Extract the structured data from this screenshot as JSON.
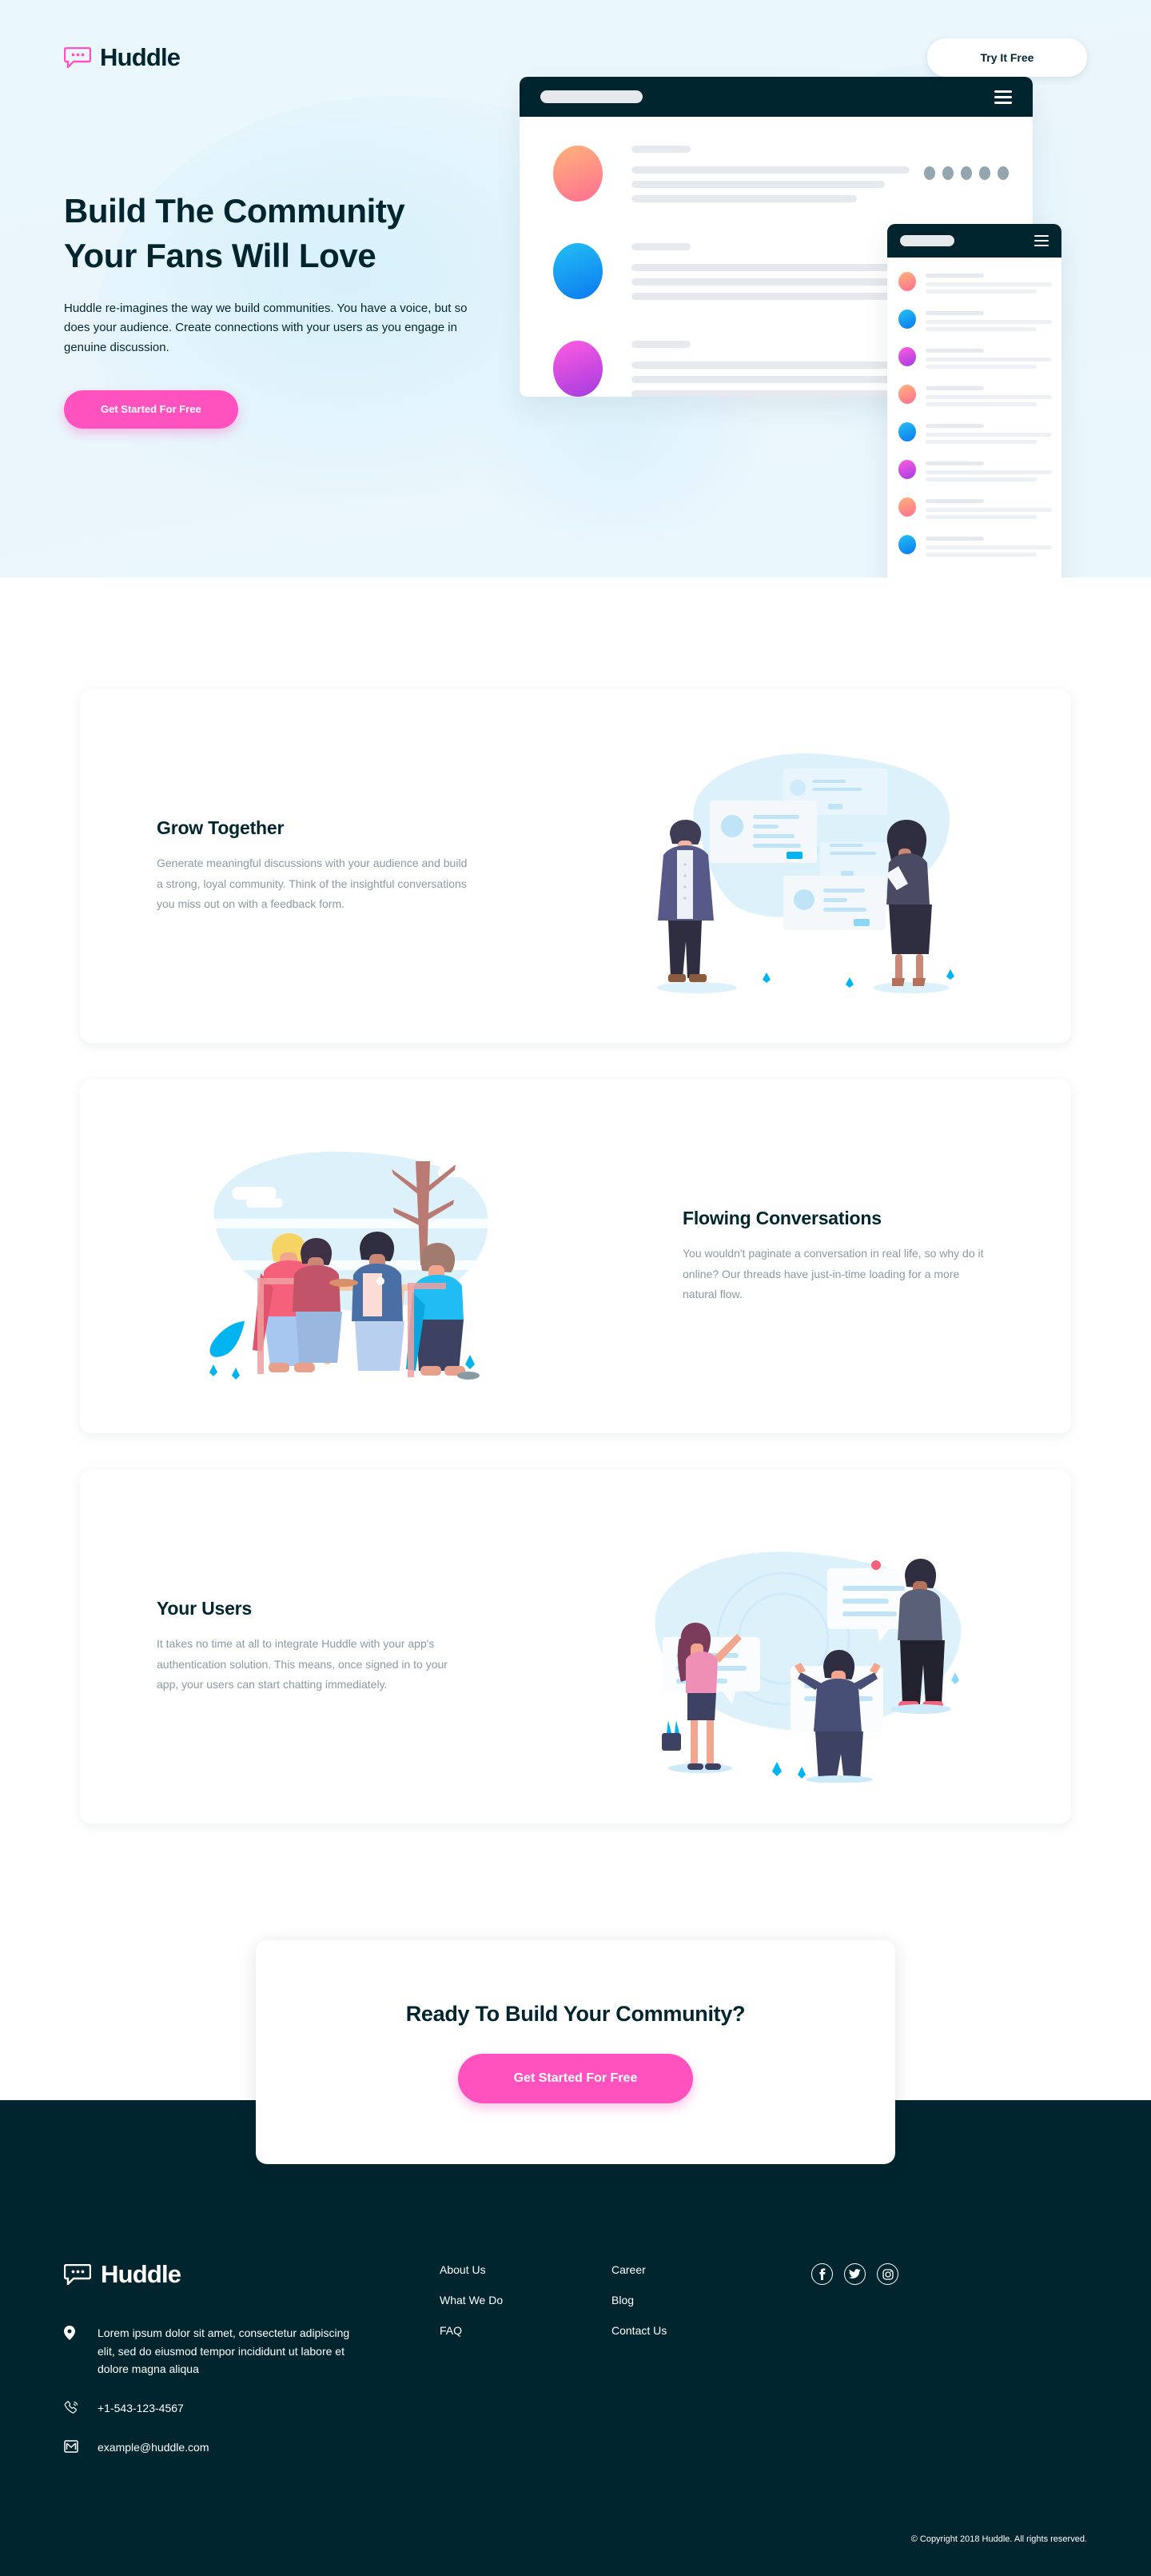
{
  "brand": {
    "name": "Huddle",
    "logo_icon": "chat-bubble-icon",
    "accent_pink": "#ff52bf",
    "dark": "#00252e",
    "hero_bg": "#eaf6fc"
  },
  "header": {
    "cta_label": "Try It Free"
  },
  "hero": {
    "title_line1": "Build The Community",
    "title_line2": "Your Fans Will Love",
    "paragraph": "Huddle re-imagines the way we build communities. You have a voice, but so does your audience. Create connections with your users as you engage in genuine discussion.",
    "cta_label": "Get Started For Free",
    "mockup": {
      "menu_icon": "hamburger-menu-icon",
      "window_rows": [
        "avatar-orange",
        "avatar-blue",
        "avatar-purple"
      ],
      "phone_rows": [
        "avatar-orange",
        "avatar-blue",
        "avatar-purple",
        "avatar-orange",
        "avatar-blue",
        "avatar-purple",
        "avatar-orange",
        "avatar-blue"
      ]
    }
  },
  "features": [
    {
      "title": "Grow Together",
      "desc": "Generate meaningful discussions with your audience and build a strong, loyal community. Think of the insightful conversations you miss out on with a feedback form.",
      "illustration": "grow-together-illustration",
      "image_side": "right"
    },
    {
      "title": "Flowing Conversations",
      "desc": "You wouldn't paginate a conversation in real life, so why do it online? Our threads have just-in-time loading for a more natural flow.",
      "illustration": "flowing-conversations-illustration",
      "image_side": "left"
    },
    {
      "title": "Your Users",
      "desc": "It takes no time at all to integrate Huddle with your app's authentication solution. This means, once signed in to your app, your users can start chatting immediately.",
      "illustration": "your-users-illustration",
      "image_side": "right"
    }
  ],
  "cta": {
    "title": "Ready To Build Your Community?",
    "button_label": "Get Started For Free"
  },
  "footer": {
    "address": "Lorem ipsum dolor sit amet, consectetur adipiscing elit, sed do eiusmod tempor incididunt ut labore et dolore magna aliqua",
    "phone": "+1-543-123-4567",
    "email": "example@huddle.com",
    "location_icon": "location-pin-icon",
    "phone_icon": "phone-icon",
    "email_icon": "envelope-icon",
    "links_col1": [
      "About Us",
      "What We Do",
      "FAQ"
    ],
    "links_col2": [
      "Career",
      "Blog",
      "Contact Us"
    ],
    "social": [
      "facebook-icon",
      "twitter-icon",
      "instagram-icon"
    ],
    "copyright": "© Copyright 2018 Huddle. All rights reserved."
  }
}
